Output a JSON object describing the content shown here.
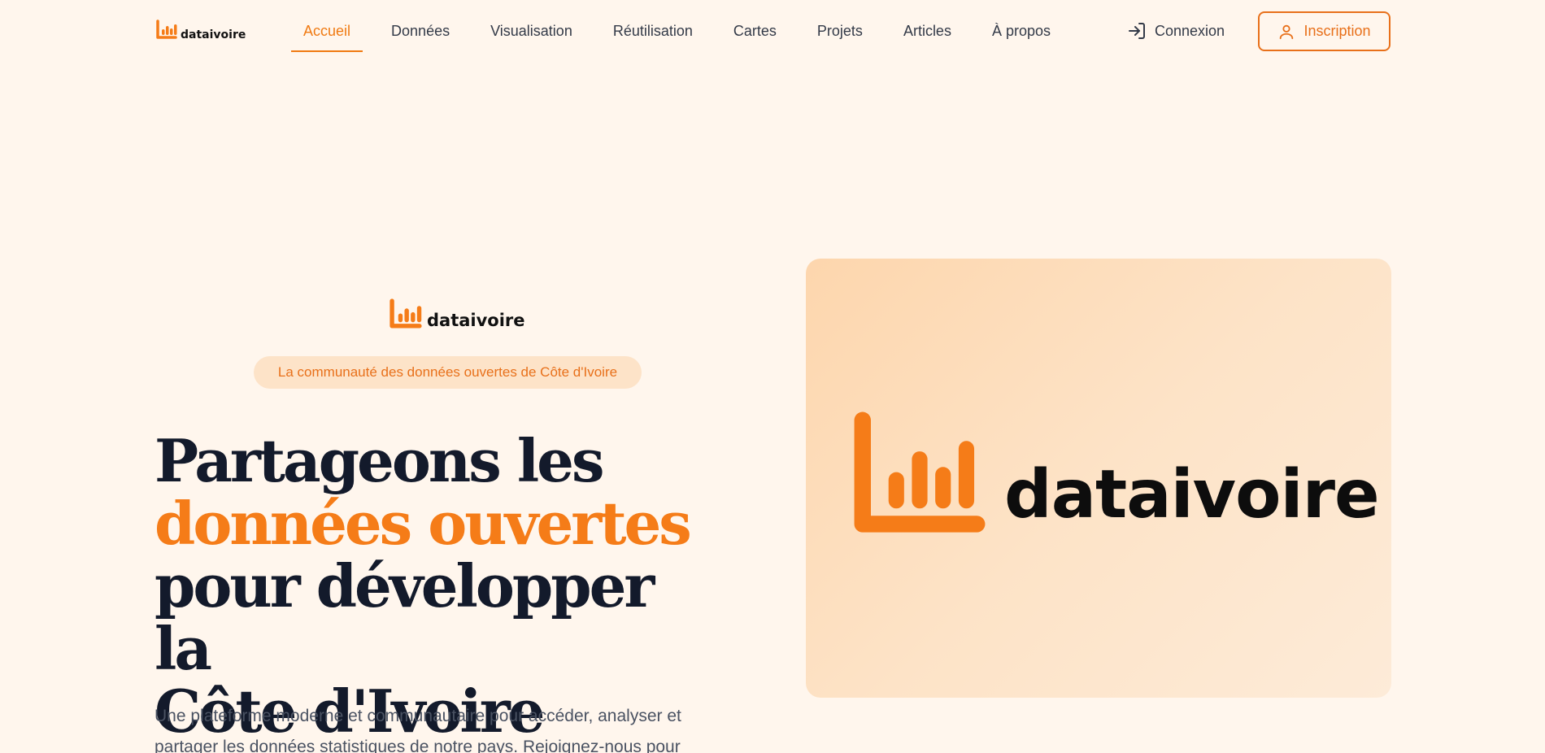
{
  "nav": {
    "logo_text": "dataivoire",
    "links": [
      "Accueil",
      "Données",
      "Visualisation",
      "Réutilisation",
      "Cartes",
      "Projets",
      "Articles",
      "À propos"
    ],
    "active": "Accueil",
    "login_label": "Connexion",
    "signup_label": "Inscription"
  },
  "hero": {
    "logo_text": "dataivoire",
    "tagline": "La communauté des données ouvertes de Côte d'Ivoire",
    "headline_line1": "Partageons les",
    "headline_accent": "données ouvertes",
    "headline_line3": "pour développer la",
    "headline_line4": "Côte d'Ivoire",
    "lead": "Une plateforme moderne et communautaire pour accéder, analyser et partager les données statistiques de notre pays. Rejoignez-nous pour"
  },
  "card": {
    "logo_text": "dataivoire"
  },
  "colors": {
    "accent": "#f57c18",
    "background": "#fff6ed",
    "headline": "#131a2b"
  },
  "icons": [
    "logo-chart-icon",
    "login-arrow-icon",
    "user-icon"
  ]
}
